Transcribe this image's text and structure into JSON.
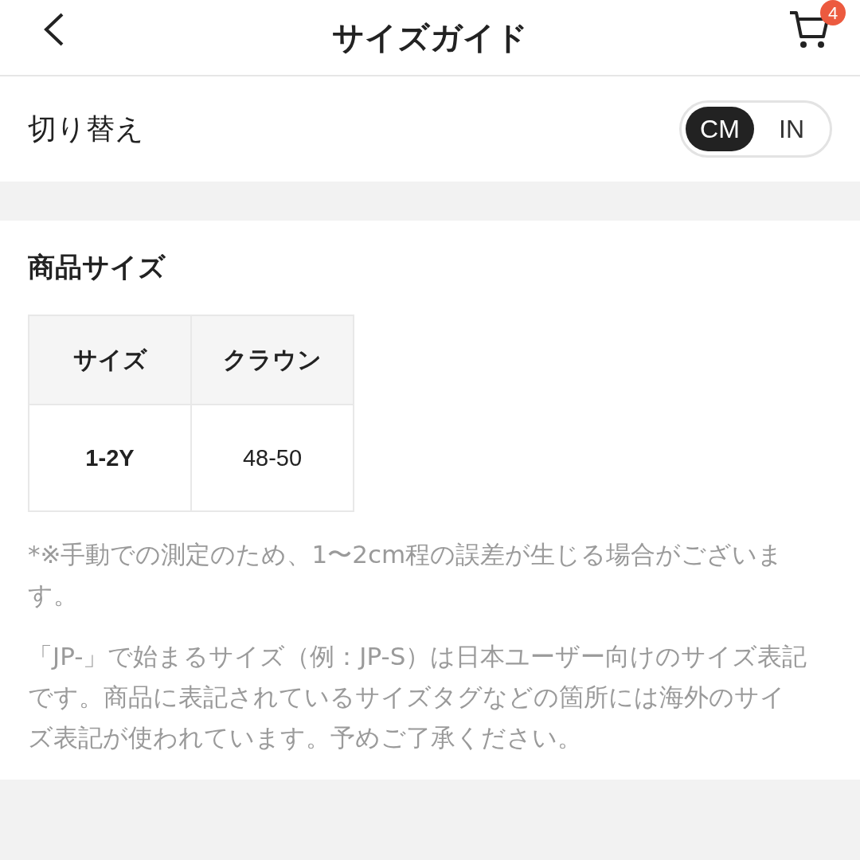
{
  "header": {
    "title": "サイズガイド",
    "cart_badge": "4"
  },
  "unit_toggle": {
    "label": "切り替え",
    "options": [
      {
        "label": "CM",
        "selected": true
      },
      {
        "label": "IN",
        "selected": false
      }
    ]
  },
  "section": {
    "title": "商品サイズ",
    "table": {
      "columns": [
        "サイズ",
        "クラウン"
      ],
      "rows": [
        [
          "1-2Y",
          "48-50"
        ]
      ]
    },
    "notes": [
      "*※手動での測定のため、1〜2cm程の誤差が生じる場合がございます。",
      "「JP-」で始まるサイズ（例：JP-S）は日本ユーザー向けのサイズ表記です。商品に表記されているサイズタグなどの箇所には海外のサイズ表記が使われています。予めご了承ください。"
    ]
  }
}
